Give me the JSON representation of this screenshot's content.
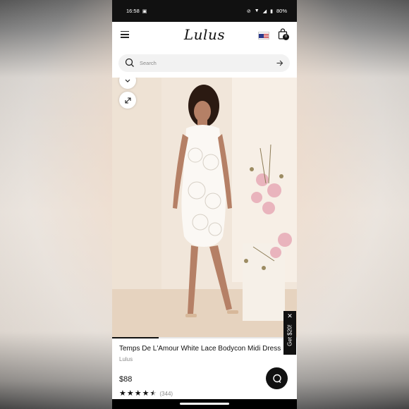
{
  "status_bar": {
    "time": "16:58",
    "battery": "80%"
  },
  "header": {
    "logo": "Lulus",
    "cart_count": "0"
  },
  "search": {
    "placeholder": "Search"
  },
  "gallery": {
    "progress": 0.25
  },
  "product": {
    "title": "Temps De L'Amour White Lace Bodycon Midi Dress",
    "brand": "Lulus",
    "price": "$88",
    "rating": 4.5,
    "review_count": "(344)"
  },
  "promo": {
    "label": "Get $20!"
  },
  "icons": {
    "menu": "menu-icon",
    "flag": "us-flag-icon",
    "bag": "shopping-bag-icon",
    "search": "search-icon",
    "arrow": "arrow-right-icon",
    "chevron": "chevron-down-icon",
    "expand": "expand-icon",
    "close": "close-icon",
    "chat": "chat-icon"
  }
}
